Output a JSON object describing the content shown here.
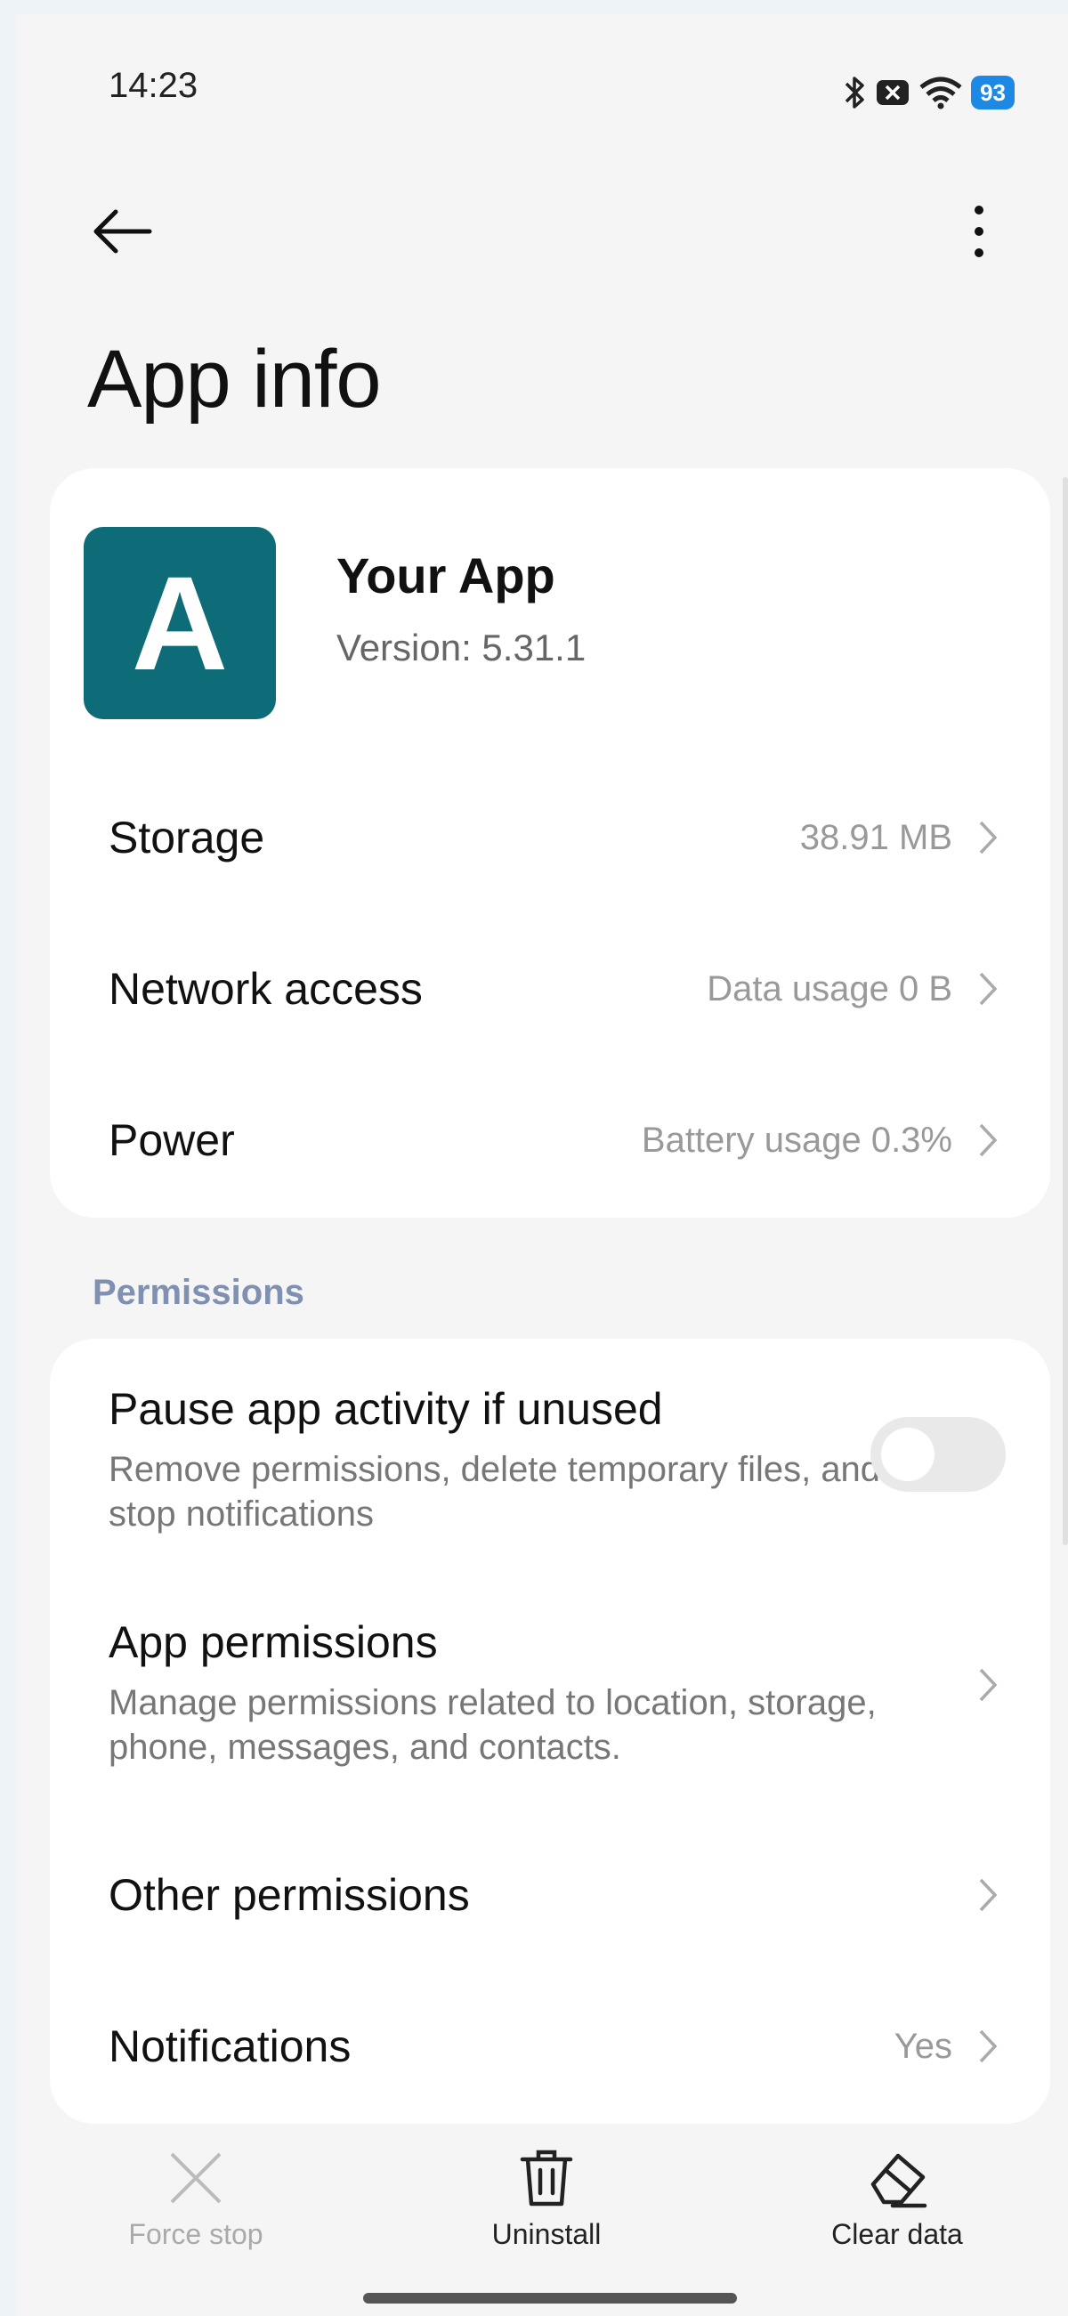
{
  "status_bar": {
    "time": "14:23",
    "battery": "93"
  },
  "page": {
    "title": "App info"
  },
  "app": {
    "icon_letter": "A",
    "name": "Your App",
    "version": "Version: 5.31.1"
  },
  "summary_rows": [
    {
      "label": "Storage",
      "value": "38.91 MB"
    },
    {
      "label": "Network access",
      "value": "Data usage 0 B"
    },
    {
      "label": "Power",
      "value": "Battery usage 0.3%"
    }
  ],
  "permissions": {
    "section_label": "Permissions",
    "pause": {
      "title": "Pause app activity if unused",
      "subtitle": "Remove permissions, delete temporary files, and stop notifications",
      "enabled": false
    },
    "app_permissions": {
      "title": "App permissions",
      "subtitle": "Manage permissions related to location, storage, phone, messages, and contacts."
    },
    "other_permissions": {
      "title": "Other permissions"
    },
    "notifications": {
      "title": "Notifications",
      "value": "Yes"
    }
  },
  "actions": {
    "force_stop": "Force stop",
    "uninstall": "Uninstall",
    "clear_data": "Clear data"
  }
}
